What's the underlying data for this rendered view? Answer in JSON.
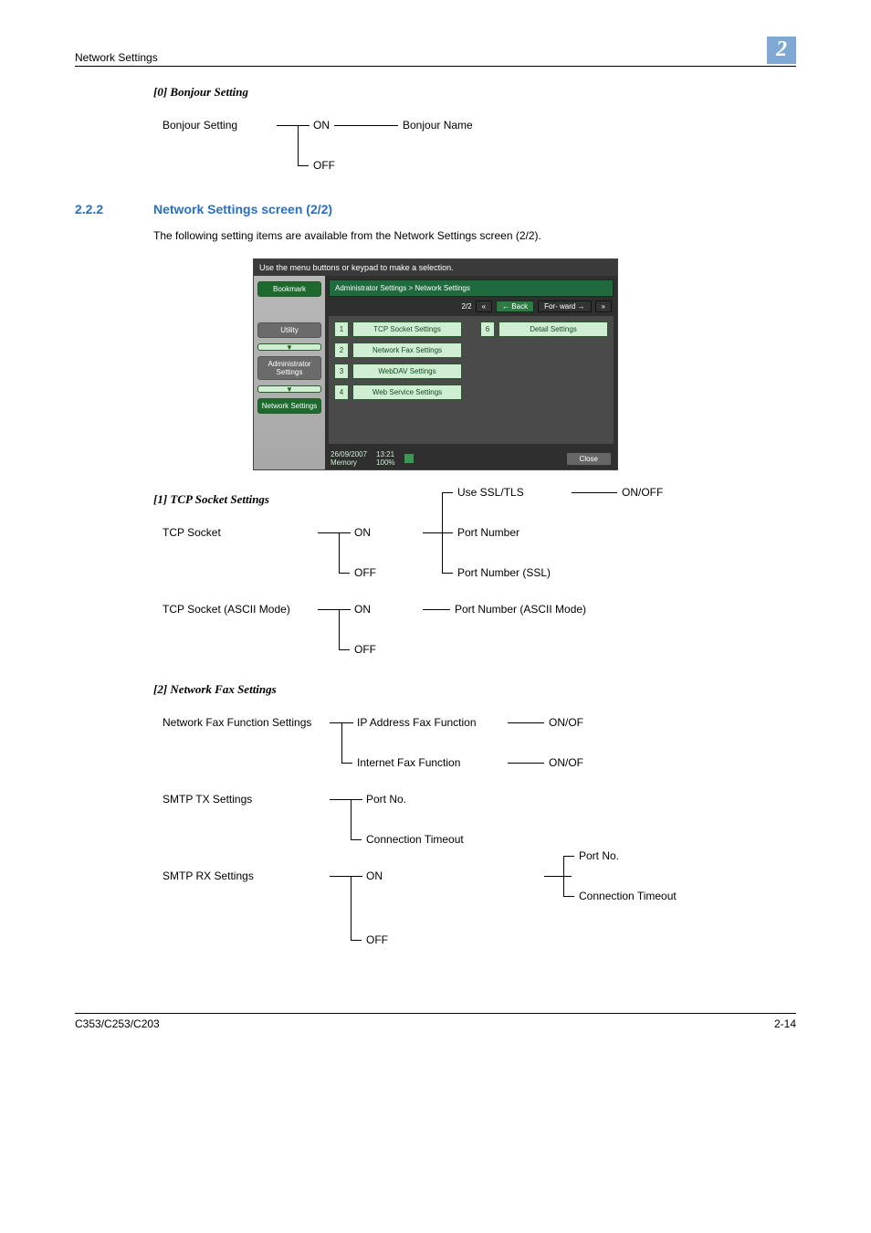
{
  "header": {
    "title": "Network Settings",
    "chapter": "2"
  },
  "sections": {
    "bonjour": {
      "heading": "[0] Bonjour Setting",
      "label": "Bonjour Setting",
      "on": "ON",
      "off": "OFF",
      "name": "Bonjour Name"
    },
    "main": {
      "num": "2.2.2",
      "title": "Network Settings screen (2/2)",
      "intro": "The following setting items are available from the Network Settings screen (2/2)."
    },
    "tcp": {
      "heading": "[1] TCP Socket Settings",
      "tcp_socket": "TCP Socket",
      "on": "ON",
      "off": "OFF",
      "use_ssl": "Use SSL/TLS",
      "onoff": "ON/OFF",
      "port_number": "Port Number",
      "port_number_ssl": "Port Number (SSL)",
      "tcp_ascii": "TCP Socket (ASCII Mode)",
      "port_ascii": "Port Number (ASCII Mode)"
    },
    "fax": {
      "heading": "[2] Network Fax Settings",
      "func": "Network Fax Function Settings",
      "ipfax": "IP Address Fax Function",
      "ifax": "Internet Fax Function",
      "onof": "ON/OF",
      "smtptx": "SMTP TX Settings",
      "portno": "Port No.",
      "conn_to": "Connection Timeout",
      "smtprx": "SMTP RX Settings",
      "on": "ON",
      "off": "OFF"
    }
  },
  "screenshot": {
    "topbar": "Use the menu buttons or keypad to make a selection.",
    "sidebar": {
      "bookmark": "Bookmark",
      "utility": "Utility",
      "admin": "Administrator Settings",
      "network": "Network Settings"
    },
    "crumb": "Administrator Settings > Network Settings",
    "page": "2/2",
    "back": "Back",
    "forward": "For- ward",
    "items": {
      "i1": "TCP Socket Settings",
      "i2": "Network Fax Settings",
      "i3": "WebDAV Settings",
      "i4": "Web Service Settings",
      "i6": "Detail Settings",
      "n1": "1",
      "n2": "2",
      "n3": "3",
      "n4": "4",
      "n6": "6"
    },
    "footer": {
      "date": "26/09/2007",
      "time": "13:21",
      "memory": "Memory",
      "mempct": "100%",
      "close": "Close"
    }
  },
  "footer": {
    "model": "C353/C253/C203",
    "page": "2-14"
  }
}
